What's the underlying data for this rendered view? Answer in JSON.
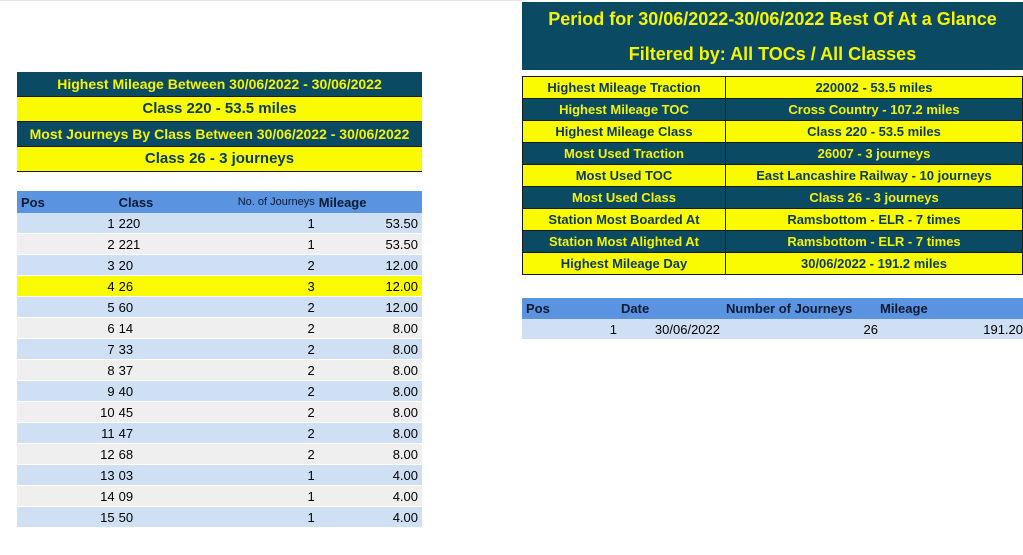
{
  "left_summary": {
    "mileage_heading": "Highest Mileage Between 30/06/2022 - 30/06/2022",
    "mileage_value": "Class 220 - 53.5 miles",
    "journeys_heading": "Most Journeys By Class Between 30/06/2022 - 30/06/2022",
    "journeys_value": "Class 26 - 3 journeys"
  },
  "class_table": {
    "headers": {
      "pos": "Pos",
      "class": "Class",
      "journeys": "No. of Journeys",
      "mileage": "Mileage"
    },
    "rows": [
      {
        "pos": "1",
        "class": "220",
        "journeys": "1",
        "mileage": "53.50"
      },
      {
        "pos": "2",
        "class": "221",
        "journeys": "1",
        "mileage": "53.50"
      },
      {
        "pos": "3",
        "class": "20",
        "journeys": "2",
        "mileage": "12.00"
      },
      {
        "pos": "4",
        "class": "26",
        "journeys": "3",
        "mileage": "12.00"
      },
      {
        "pos": "5",
        "class": "60",
        "journeys": "2",
        "mileage": "12.00"
      },
      {
        "pos": "6",
        "class": "14",
        "journeys": "2",
        "mileage": "8.00"
      },
      {
        "pos": "7",
        "class": "33",
        "journeys": "2",
        "mileage": "8.00"
      },
      {
        "pos": "8",
        "class": "37",
        "journeys": "2",
        "mileage": "8.00"
      },
      {
        "pos": "9",
        "class": "40",
        "journeys": "2",
        "mileage": "8.00"
      },
      {
        "pos": "10",
        "class": "45",
        "journeys": "2",
        "mileage": "8.00"
      },
      {
        "pos": "11",
        "class": "47",
        "journeys": "2",
        "mileage": "8.00"
      },
      {
        "pos": "12",
        "class": "68",
        "journeys": "2",
        "mileage": "8.00"
      },
      {
        "pos": "13",
        "class": "03",
        "journeys": "1",
        "mileage": "4.00"
      },
      {
        "pos": "14",
        "class": "09",
        "journeys": "1",
        "mileage": "4.00"
      },
      {
        "pos": "15",
        "class": "50",
        "journeys": "1",
        "mileage": "4.00"
      }
    ]
  },
  "glance": {
    "title": "Period for 30/06/2022-30/06/2022 Best Of At a Glance",
    "filter": "Filtered by: All TOCs / All Classes",
    "rows": [
      {
        "label": "Highest Mileage Traction",
        "value": "220002 - 53.5 miles"
      },
      {
        "label": "Highest Mileage TOC",
        "value": "Cross Country - 107.2 miles"
      },
      {
        "label": "Highest Mileage Class",
        "value": "Class 220 - 53.5 miles"
      },
      {
        "label": "Most Used Traction",
        "value": "26007 - 3 journeys"
      },
      {
        "label": "Most Used TOC",
        "value": "East Lancashire Railway - 10 journeys"
      },
      {
        "label": "Most Used Class",
        "value": "Class 26 - 3 journeys"
      },
      {
        "label": "Station Most Boarded At",
        "value": "Ramsbottom - ELR - 7 times"
      },
      {
        "label": "Station Most Alighted At",
        "value": "Ramsbottom - ELR - 7 times"
      },
      {
        "label": "Highest Mileage Day",
        "value": "30/06/2022 - 191.2 miles"
      }
    ]
  },
  "day_table": {
    "headers": {
      "pos": "Pos",
      "date": "Date",
      "journeys": "Number of Journeys",
      "mileage": "Mileage"
    },
    "rows": [
      {
        "pos": "1",
        "date": "30/06/2022",
        "journeys": "26",
        "mileage": "191.20"
      }
    ]
  },
  "colors": {
    "dark": "#0b4a63",
    "bright": "#fbfb00",
    "header_blue": "#5a93e0",
    "row_blue": "#cfe0f4"
  }
}
